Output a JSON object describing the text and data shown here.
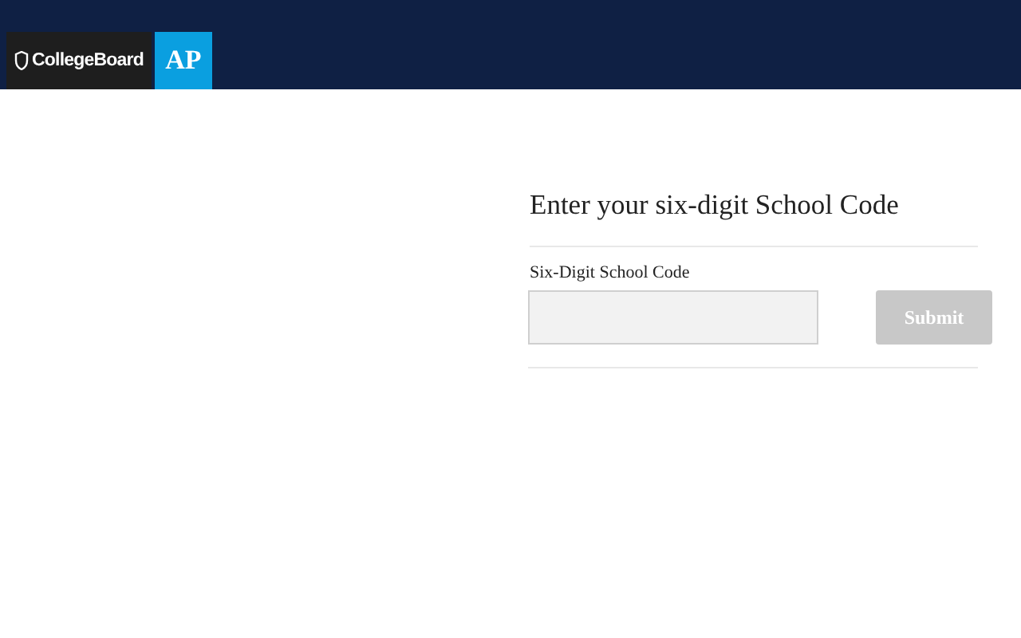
{
  "header": {
    "brand": "CollegeBoard",
    "product": "AP"
  },
  "form": {
    "title": "Enter your six-digit School Code",
    "field_label": "Six-Digit School Code",
    "submit": {
      "label": "Submit",
      "disabled": true
    }
  }
}
